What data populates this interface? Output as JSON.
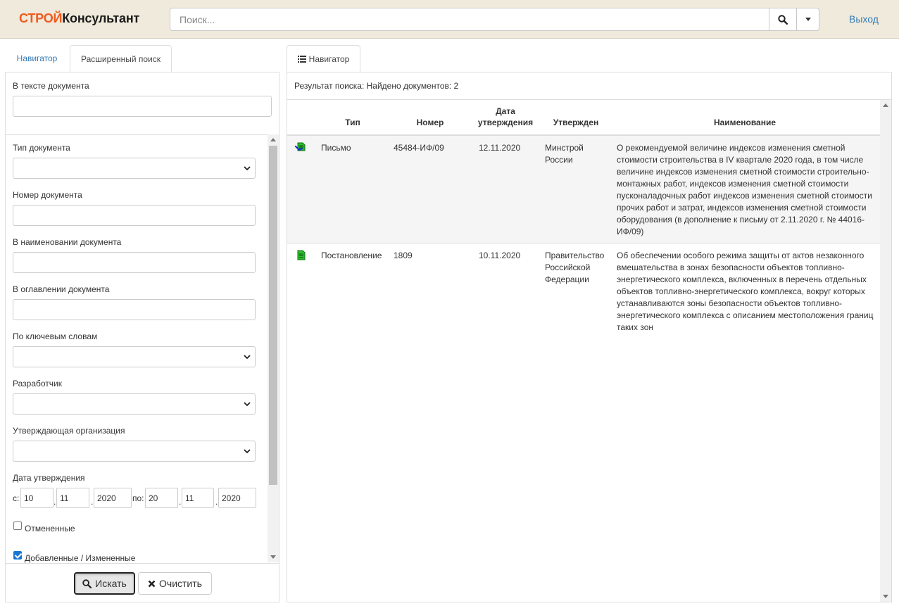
{
  "header": {
    "logo_part1": "СТРОЙ",
    "logo_part2": "Консультант",
    "search_placeholder": "Поиск...",
    "logout": "Выход"
  },
  "left": {
    "tabs": [
      "Навигатор",
      "Расширенный поиск"
    ],
    "in_text_label": "В тексте документа",
    "doc_type_label": "Тип документа",
    "doc_number_label": "Номер документа",
    "in_name_label": "В наименовании документа",
    "in_toc_label": "В оглавлении документа",
    "keywords_label": "По ключевым словам",
    "developer_label": "Разработчик",
    "approving_org_label": "Утверждающая организация",
    "approval_date_label": "Дата утверждения",
    "from_label": "с:",
    "to_label": "по:",
    "date_from": {
      "day": "10",
      "month": "11",
      "year": "2020"
    },
    "date_to": {
      "day": "20",
      "month": "11",
      "year": "2020"
    },
    "cancelled_label": "Отмененные",
    "cancelled_checked": false,
    "added_changed_label": "Добавленные / Измененные",
    "added_changed_checked": true,
    "search_button": "Искать",
    "clear_button": "Очистить"
  },
  "right": {
    "tab": "Навигатор",
    "result_text": "Результат поиска: Найдено документов: 2",
    "columns": {
      "type": "Тип",
      "number": "Номер",
      "date_line1": "Дата",
      "date_line2": "утверждения",
      "approved": "Утвержден",
      "name": "Наименование"
    },
    "rows": [
      {
        "type": "Письмо",
        "number": "45484-ИФ/09",
        "date": "12.11.2020",
        "approved_lines": [
          "Минстрой",
          "России"
        ],
        "name_lines": [
          "О рекомендуемой величине индексов изменения сметной",
          "стоимости строительства в IV квартале 2020 года, в том числе",
          "величине индексов изменения сметной стоимости строительно-",
          "монтажных работ, индексов изменения сметной стоимости",
          "пусконаладочных работ индексов изменения сметной стоимости",
          "прочих работ и затрат, индексов изменения сметной стоимости",
          "оборудования (в дополнение к письму от 2.11.2020 г. № 44016-",
          "ИФ/09)"
        ]
      },
      {
        "type": "Постановление",
        "number": "1809",
        "date": "10.11.2020",
        "approved_lines": [
          "Правительство",
          "Российской",
          "Федерации"
        ],
        "name_lines": [
          "Об обеспечении особого режима защиты от актов незаконного",
          "вмешательства в зонах безопасности объектов топливно-",
          "энергетического комплекса, включенных в перечень отдельных",
          "объектов топливно-энергетического комплекса, вокруг которых",
          "устанавливаются зоны безопасности объектов топливно-",
          "энергетического комплекса с описанием местоположения границ",
          "таких зон"
        ]
      }
    ]
  }
}
